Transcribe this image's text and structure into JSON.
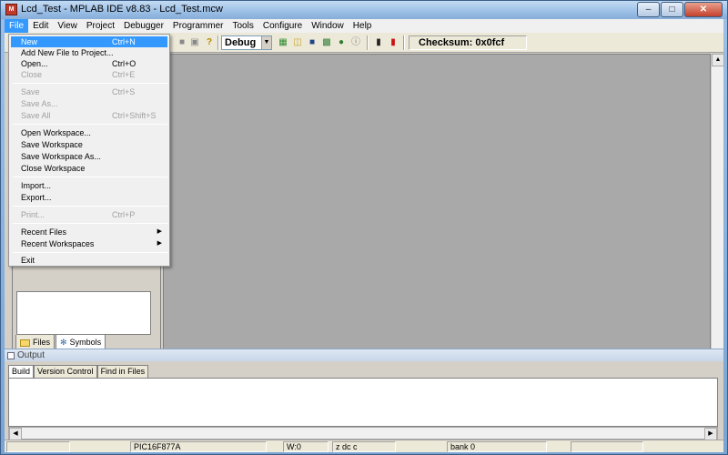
{
  "window": {
    "title": "Lcd_Test - MPLAB IDE v8.83 - Lcd_Test.mcw",
    "app_icon_text": "M"
  },
  "menubar": {
    "items": [
      "File",
      "Edit",
      "View",
      "Project",
      "Debugger",
      "Programmer",
      "Tools",
      "Configure",
      "Window",
      "Help"
    ]
  },
  "toolbar": {
    "build_config": "Debug",
    "checksum": "Checksum:  0x0fcf"
  },
  "file_menu": {
    "items": [
      {
        "label": "New",
        "shortcut": "Ctrl+N",
        "state": "highlighted"
      },
      {
        "label": "Add New File to Project...",
        "shortcut": "",
        "state": "enabled"
      },
      {
        "label": "Open...",
        "shortcut": "Ctrl+O",
        "state": "enabled"
      },
      {
        "label": "Close",
        "shortcut": "Ctrl+E",
        "state": "disabled"
      },
      {
        "label": "Save",
        "shortcut": "Ctrl+S",
        "state": "disabled"
      },
      {
        "label": "Save As...",
        "shortcut": "",
        "state": "disabled"
      },
      {
        "label": "Save All",
        "shortcut": "Ctrl+Shift+S",
        "state": "disabled"
      },
      {
        "label": "Open Workspace...",
        "shortcut": "",
        "state": "enabled"
      },
      {
        "label": "Save Workspace",
        "shortcut": "",
        "state": "enabled"
      },
      {
        "label": "Save Workspace As...",
        "shortcut": "",
        "state": "enabled"
      },
      {
        "label": "Close Workspace",
        "shortcut": "",
        "state": "enabled"
      },
      {
        "label": "Import...",
        "shortcut": "",
        "state": "enabled"
      },
      {
        "label": "Export...",
        "shortcut": "",
        "state": "enabled"
      },
      {
        "label": "Print...",
        "shortcut": "Ctrl+P",
        "state": "disabled"
      },
      {
        "label": "Recent Files",
        "shortcut": "",
        "state": "submenu"
      },
      {
        "label": "Recent Workspaces",
        "shortcut": "",
        "state": "submenu"
      },
      {
        "label": "Exit",
        "shortcut": "",
        "state": "enabled"
      }
    ]
  },
  "workspace": {
    "tabs": [
      "Files",
      "Symbols"
    ]
  },
  "output": {
    "title": "Output",
    "tabs": [
      "Build",
      "Version Control",
      "Find in Files"
    ]
  },
  "statusbar": {
    "device": "PIC16F877A",
    "w_reg": "W:0",
    "flags": "z dc c",
    "bank": "bank 0"
  },
  "colors": {
    "highlight": "#3399ff",
    "mdi_background": "#a9a9a9",
    "titlebar": "#9bbfe6"
  }
}
